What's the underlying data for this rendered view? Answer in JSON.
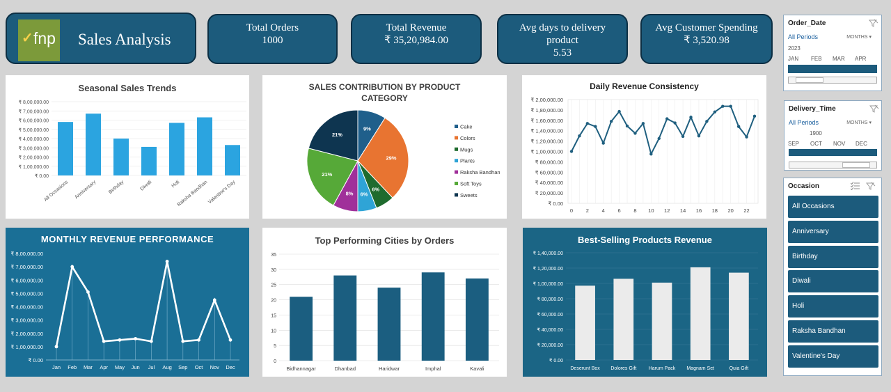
{
  "header": {
    "brand_glyph": "✓",
    "brand_logo_text": "fnp",
    "title": "Sales Analysis"
  },
  "kpis": [
    {
      "label": "Total Orders",
      "value": "1000"
    },
    {
      "label": "Total Revenue",
      "value": "₹ 35,20,984.00"
    },
    {
      "label": "Avg days to delivery product",
      "value": "5.53"
    },
    {
      "label": "Avg Customer Spending",
      "value": "₹ 3,520.98"
    }
  ],
  "slicers": {
    "order_date": {
      "title": "Order_Date",
      "all_periods": "All Periods",
      "granularity": "MONTHS",
      "year": "2023",
      "months": [
        "JAN",
        "FEB",
        "MAR",
        "APR"
      ]
    },
    "delivery_time": {
      "title": "Delivery_Time",
      "all_periods": "All Periods",
      "granularity": "MONTHS",
      "year": "1900",
      "months": [
        "SEP",
        "OCT",
        "NOV",
        "DEC"
      ]
    },
    "occasion": {
      "title": "Occasion",
      "items": [
        "All Occasions",
        "Anniversary",
        "Birthday",
        "Diwali",
        "Holi",
        "Raksha Bandhan",
        "Valentine's Day"
      ]
    }
  },
  "colors": {
    "bar_light": "#2ba4e0",
    "line_blue": "#1f5f7f",
    "bar_dark": "#1b5e80",
    "bar_white": "#ebebeb"
  },
  "chart_data": [
    {
      "id": "seasonal",
      "type": "bar",
      "title": "Seasonal Sales Trends",
      "categories": [
        "All Occasions",
        "Anniversary",
        "Birthday",
        "Diwali",
        "Holi",
        "Raksha Bandhan",
        "Valentine's Day"
      ],
      "values": [
        580000,
        670000,
        400000,
        310000,
        570000,
        630000,
        330000
      ],
      "ylim": [
        0,
        800000
      ],
      "ytick_labels": [
        "₹ 0.00",
        "₹ 1,00,000.00",
        "₹ 2,00,000.00",
        "₹ 3,00,000.00",
        "₹ 4,00,000.00",
        "₹ 5,00,000.00",
        "₹ 6,00,000.00",
        "₹ 7,00,000.00",
        "₹ 8,00,000.00"
      ],
      "grid": true
    },
    {
      "id": "category",
      "type": "pie",
      "title": "SALES CONTRIBUTION BY PRODUCT CATEGORY",
      "categories": [
        "Cake",
        "Colors",
        "Mugs",
        "Plants",
        "Raksha Bandhan",
        "Soft Toys",
        "Sweets"
      ],
      "values": [
        9,
        29,
        6,
        6,
        8,
        21,
        21
      ],
      "labels": [
        "9%",
        "29%",
        "6%",
        "6%",
        "8%",
        "21%",
        "21%"
      ],
      "colors": [
        "#1f5f8b",
        "#e87431",
        "#1f6b2e",
        "#2fa4d6",
        "#a0309a",
        "#56a938",
        "#0e3550"
      ],
      "legend": "right"
    },
    {
      "id": "daily",
      "type": "line",
      "title": "Daily Revenue Consistency",
      "x": [
        0,
        1,
        2,
        3,
        4,
        5,
        6,
        7,
        8,
        9,
        10,
        11,
        12,
        13,
        14,
        15,
        16,
        17,
        18,
        19,
        20,
        21,
        22,
        23
      ],
      "values": [
        100000,
        130000,
        154000,
        148000,
        116000,
        158000,
        177000,
        149000,
        135000,
        154000,
        95000,
        125000,
        163000,
        155000,
        129000,
        166000,
        130000,
        158000,
        176000,
        187000,
        187000,
        148000,
        128000,
        168000
      ],
      "ylim": [
        0,
        200000
      ],
      "ytick_labels": [
        "₹ 0.00",
        "₹ 20,000.00",
        "₹ 40,000.00",
        "₹ 60,000.00",
        "₹ 80,000.00",
        "₹ 1,00,000.00",
        "₹ 1,20,000.00",
        "₹ 1,40,000.00",
        "₹ 1,60,000.00",
        "₹ 1,80,000.00",
        "₹ 2,00,000.00"
      ],
      "xtick_labels": [
        "0",
        "2",
        "4",
        "6",
        "8",
        "10",
        "12",
        "14",
        "16",
        "18",
        "20",
        "22"
      ],
      "grid": true
    },
    {
      "id": "monthly",
      "type": "line",
      "title": "MONTHLY REVENUE PERFORMANCE",
      "categories": [
        "Jan",
        "Feb",
        "Mar",
        "Apr",
        "May",
        "Jun",
        "Jul",
        "Aug",
        "Sep",
        "Oct",
        "Nov",
        "Dec"
      ],
      "values": [
        100000,
        700000,
        510000,
        140000,
        150000,
        160000,
        140000,
        740000,
        140000,
        150000,
        450000,
        150000
      ],
      "ylim": [
        0,
        800000
      ],
      "ytick_labels": [
        "₹ 0.00",
        "₹ 1,00,000.00",
        "₹ 2,00,000.00",
        "₹ 3,00,000.00",
        "₹ 4,00,000.00",
        "₹ 5,00,000.00",
        "₹ 6,00,000.00",
        "₹ 7,00,000.00",
        "₹ 8,00,000.00"
      ]
    },
    {
      "id": "cities",
      "type": "bar",
      "title": "Top Performing Cities by Orders",
      "categories": [
        "Bidhannagar",
        "Dhanbad",
        "Haridwar",
        "Imphal",
        "Kavali"
      ],
      "values": [
        21,
        28,
        24,
        29,
        27
      ],
      "ylim": [
        0,
        35
      ],
      "ytick_labels": [
        "0",
        "5",
        "10",
        "15",
        "20",
        "25",
        "30",
        "35"
      ],
      "grid": true
    },
    {
      "id": "products",
      "type": "bar",
      "title": "Best-Selling Products Revenue",
      "categories": [
        "Deserunt Box",
        "Dolores Gift",
        "Harum Pack",
        "Magnam Set",
        "Quia Gift"
      ],
      "values": [
        97000,
        106000,
        101000,
        121000,
        114000
      ],
      "ylim": [
        0,
        140000
      ],
      "ytick_labels": [
        "₹ 0.00",
        "₹ 20,000.00",
        "₹ 40,000.00",
        "₹ 60,000.00",
        "₹ 80,000.00",
        "₹ 1,00,000.00",
        "₹ 1,20,000.00",
        "₹ 1,40,000.00"
      ],
      "grid": true
    }
  ]
}
